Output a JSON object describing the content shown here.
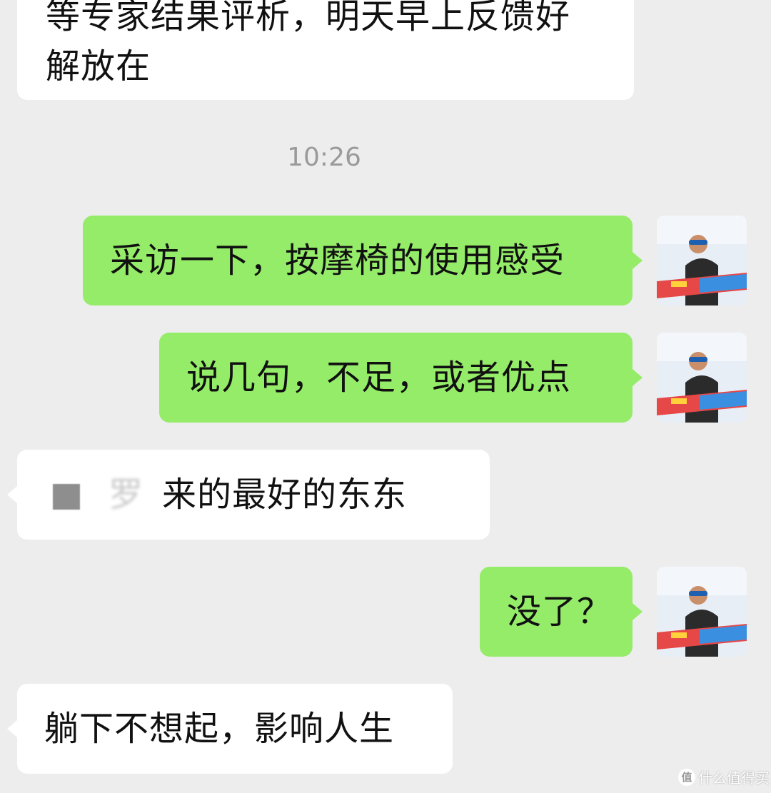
{
  "timestamp": "10:26",
  "messages": [
    {
      "side": "left",
      "lines": [
        "等专家结果评析，明天早上反馈好",
        "解放在"
      ]
    },
    {
      "side": "right",
      "text": "采访一下，按摩椅的使用感受"
    },
    {
      "side": "right",
      "text": "说几句，不足，或者优点"
    },
    {
      "side": "left",
      "obscured": true,
      "text": "来的最好的东东"
    },
    {
      "side": "right",
      "text": "没了？"
    },
    {
      "side": "left",
      "text": "躺下不想起，影响人生"
    }
  ],
  "watermark": {
    "icon": "值",
    "text": "什么值得买"
  },
  "colors": {
    "background": "#ededed",
    "incoming_bubble": "#ffffff",
    "outgoing_bubble": "#95ec69"
  }
}
